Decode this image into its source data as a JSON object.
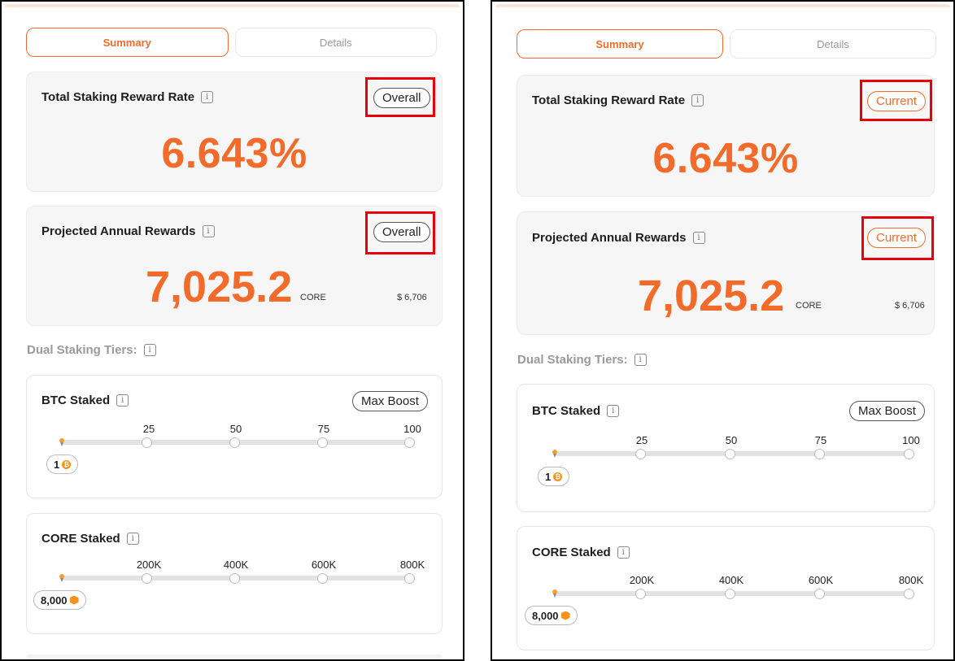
{
  "left": {
    "tabs": {
      "summary": "Summary",
      "details": "Details"
    },
    "reward_rate": {
      "title": "Total Staking Reward Rate",
      "mode": "Overall",
      "value": "6.643%"
    },
    "annual_rewards": {
      "title": "Projected Annual Rewards",
      "mode": "Overall",
      "value": "7,025.2",
      "unit": "CORE",
      "usd": "$ 6,706"
    },
    "tiers_label": "Dual Staking Tiers:",
    "btc": {
      "title": "BTC Staked",
      "boost": "Max Boost",
      "ticks": [
        "25",
        "50",
        "75",
        "100"
      ],
      "value": "1"
    },
    "core": {
      "title": "CORE Staked",
      "ticks": [
        "200K",
        "400K",
        "600K",
        "800K"
      ],
      "value": "8,000"
    }
  },
  "right": {
    "tabs": {
      "summary": "Summary",
      "details": "Details"
    },
    "reward_rate": {
      "title": "Total Staking Reward Rate",
      "mode": "Current",
      "value": "6.643%"
    },
    "annual_rewards": {
      "title": "Projected Annual Rewards",
      "mode": "Current",
      "value": "7,025.2",
      "unit": "CORE",
      "usd": "$ 6,706"
    },
    "tiers_label": "Dual Staking Tiers:",
    "btc": {
      "title": "BTC Staked",
      "boost": "Max Boost",
      "ticks": [
        "25",
        "50",
        "75",
        "100"
      ],
      "value": "1"
    },
    "core": {
      "title": "CORE Staked",
      "ticks": [
        "200K",
        "400K",
        "600K",
        "800K"
      ],
      "value": "8,000"
    }
  },
  "icons": {
    "info": "i",
    "btc_coin": "₿"
  },
  "colors": {
    "accent": "#f26b2a",
    "highlight": "#e8000b"
  }
}
